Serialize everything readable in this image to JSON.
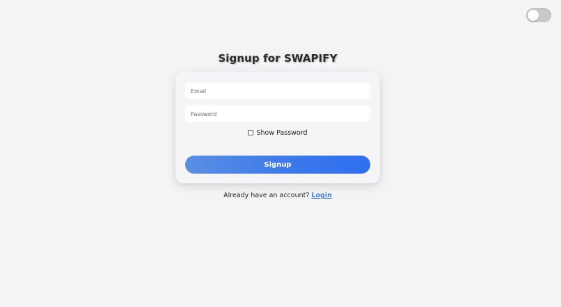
{
  "theme_toggle": {
    "state": "off"
  },
  "page_title": "Signup for SWAPIFY",
  "form": {
    "email": {
      "placeholder": "Email",
      "value": ""
    },
    "password": {
      "placeholder": "Password",
      "value": ""
    },
    "show_password_label": "Show Password",
    "show_password_checked": false,
    "submit_label": "Signup"
  },
  "footer": {
    "prompt": "Already have an account?",
    "link_label": "Login"
  },
  "colors": {
    "background": "#f4f4f6",
    "card": "#f5f5f7",
    "button_gradient_start": "#5b8fe3",
    "button_gradient_end": "#2f6ff0",
    "link": "#3a78d8"
  }
}
